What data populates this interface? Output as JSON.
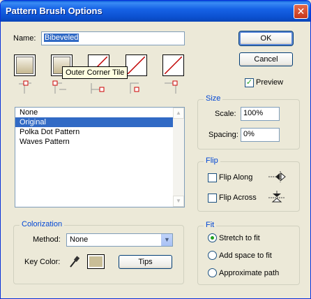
{
  "window": {
    "title": "Pattern Brush Options",
    "close_glyph": "✕"
  },
  "name_field": {
    "label": "Name:",
    "value": "Bibeveled"
  },
  "buttons": {
    "ok": "OK",
    "cancel": "Cancel",
    "tips": "Tips"
  },
  "preview": {
    "label": "Preview",
    "checked": true
  },
  "tiles": [
    {
      "name": "side-tile",
      "state": "pattern"
    },
    {
      "name": "outer-corner-tile",
      "state": "pattern"
    },
    {
      "name": "inner-corner-tile",
      "state": "none"
    },
    {
      "name": "start-tile",
      "state": "none"
    },
    {
      "name": "end-tile",
      "state": "none"
    }
  ],
  "tooltip": "Outer Corner Tile",
  "pattern_list": {
    "items": [
      "None",
      "Original",
      "Polka Dot Pattern",
      "Waves Pattern"
    ],
    "selected_index": 1
  },
  "size": {
    "title": "Size",
    "scale_label": "Scale:",
    "scale_value": "100%",
    "spacing_label": "Spacing:",
    "spacing_value": "0%"
  },
  "flip": {
    "title": "Flip",
    "along_label": "Flip Along",
    "along_checked": false,
    "across_label": "Flip Across",
    "across_checked": false
  },
  "fit": {
    "title": "Fit",
    "options": [
      "Stretch to fit",
      "Add space to fit",
      "Approximate path"
    ],
    "selected_index": 0
  },
  "colorization": {
    "title": "Colorization",
    "method_label": "Method:",
    "method_value": "None",
    "key_color_label": "Key Color:",
    "key_color": "#c9be97"
  },
  "colors": {
    "titlebar": "#0b50cf",
    "selection": "#316ac5",
    "group_title": "#0046d5",
    "dialog_bg": "#ece9d8"
  }
}
